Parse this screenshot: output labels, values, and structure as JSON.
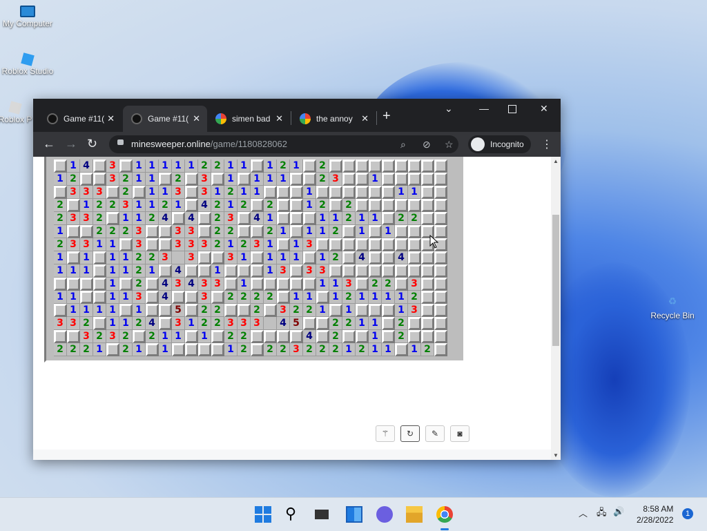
{
  "desktop": {
    "icons": [
      {
        "label": "My Computer"
      },
      {
        "label": "Roblox Studio"
      },
      {
        "label": "Roblox P"
      },
      {
        "label": "Recycle Bin"
      }
    ]
  },
  "browser": {
    "tabs": [
      {
        "title": "Game #11(",
        "icon": "minesweeper-icon"
      },
      {
        "title": "Game #11(",
        "icon": "minesweeper-icon",
        "active": true
      },
      {
        "title": "simen bad",
        "icon": "google-icon"
      },
      {
        "title": "the annoy",
        "icon": "google-icon"
      }
    ],
    "new_tab": "+",
    "url_host": "minesweeper.online",
    "url_path": "/game/1180828062",
    "profile_label": "Incognito"
  },
  "board": {
    "rows": [
      "_14_3_111112211_121_2_________",
      "12__3211_2_3_1_111__23__1_____",
      "_333_2_113_31211___1______11__",
      "2_12231121_4212_2__12_2_______",
      "2332_1124_4_23_41___11211_22__",
      "1__2223__33_22__21_112_1_1____",
      "23311_3__33321231_13__________",
      "1_1_11223 3__31_111_12_4__4___",
      "111_1121_4__1___13_33_________",
      "____1_2_43433_1_____113_22_3__",
      "11__113_4__3_2222_11_1211112__",
      "_1111_1__5_22__2_3221_1___13__",
      "332_1124_3122333 45__2211_2___",
      "__3232_211_1_22____4_2__1_2___",
      "2221_21_1____12_2232221211_12_"
    ],
    "legend": "_ = unrevealed; digits = adjacent mine counts; space = revealed blank"
  },
  "tools": [
    "wand-icon",
    "restart-icon",
    "edit-icon",
    "camera-icon"
  ],
  "taskbar": {
    "clock_time": "8:58 AM",
    "clock_date": "2/28/2022",
    "notification_count": "1"
  }
}
